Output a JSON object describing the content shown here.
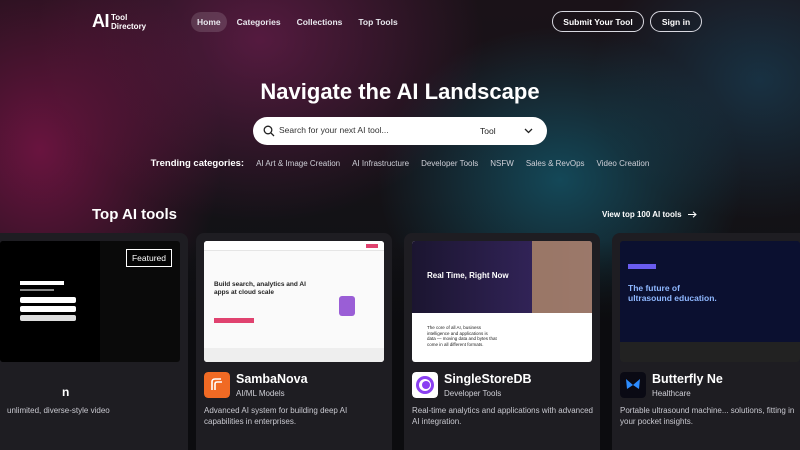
{
  "header": {
    "logo_mark": "AI",
    "logo_line1": "Tool",
    "logo_line2": "Directory",
    "nav": [
      "Home",
      "Categories",
      "Collections",
      "Top Tools"
    ],
    "submit_label": "Submit Your Tool",
    "signin_label": "Sign in"
  },
  "hero": {
    "title": "Navigate the AI Landscape",
    "search_placeholder": "Search for your next AI tool...",
    "search_type": "Tool",
    "trending_label": "Trending categories:",
    "trending": [
      "AI Art & Image Creation",
      "AI Infrastructure",
      "Developer Tools",
      "NSFW",
      "Sales & RevOps",
      "Video Creation"
    ]
  },
  "section": {
    "title": "Top AI tools",
    "view_all": "View top 100 AI tools"
  },
  "cards": [
    {
      "badge": "Featured",
      "name": "",
      "category": "",
      "name_tail": "n",
      "desc": "unlimited, diverse-style video"
    },
    {
      "name": "SambaNova",
      "category": "AI/ML Models",
      "desc": "Advanced AI system for building deep AI capabilities in enterprises.",
      "thumb_headline": "Build search, analytics and AI apps at cloud scale"
    },
    {
      "name": "SingleStoreDB",
      "category": "Developer Tools",
      "desc": "Real-time analytics and applications with advanced AI integration.",
      "thumb_headline": "Real Time, Right Now",
      "thumb_sub": "The core of all AI, business intelligence and applications is data — moving data and bytes that come in all different formats."
    },
    {
      "name": "Butterfly Ne",
      "category": "Healthcare",
      "desc": "Portable ultrasound machine... solutions, fitting in your pocket insights.",
      "thumb_headline": "The future of ultrasound education."
    }
  ],
  "colors": {
    "accent_pink": "#e0426f",
    "samba_orange": "#f06a24",
    "singlestore_purple": "#8a3ff2",
    "butterfly_blue": "#2d8cff"
  }
}
